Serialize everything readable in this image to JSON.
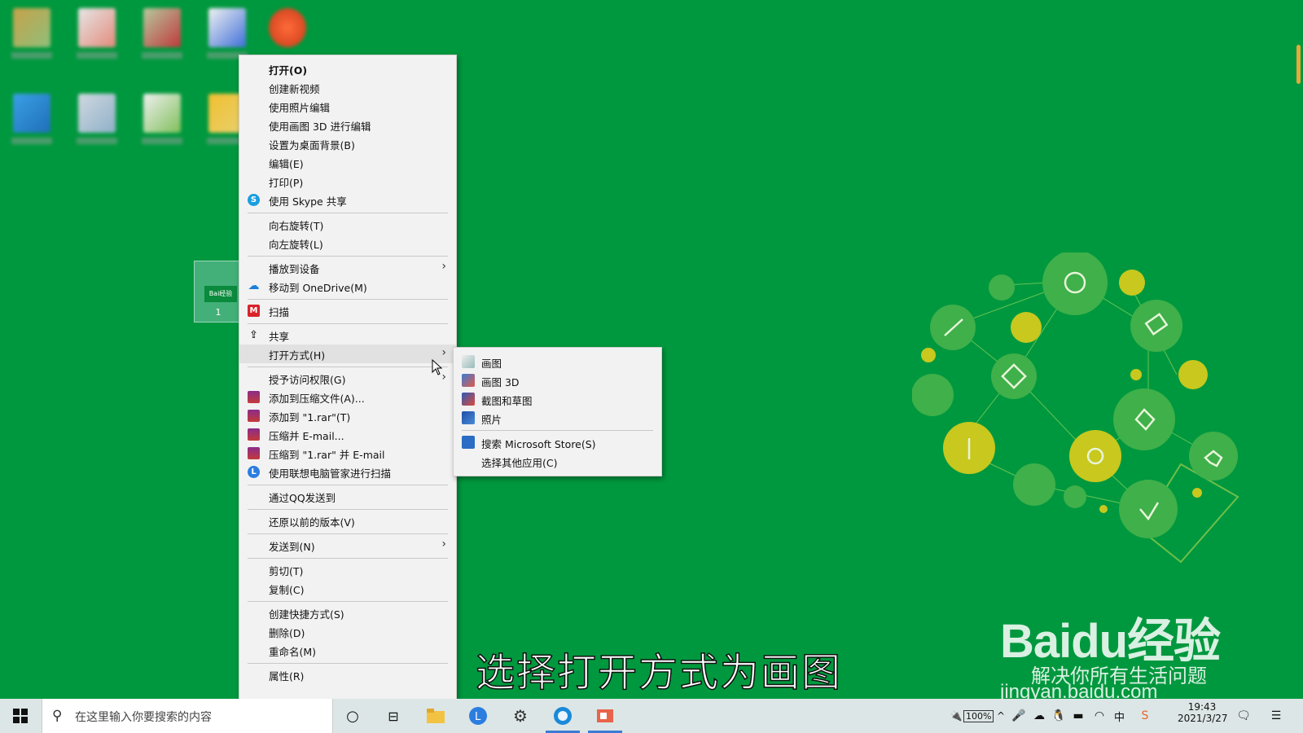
{
  "context_menu": {
    "items": [
      {
        "label": "打开(O)"
      },
      {
        "label": "创建新视频"
      },
      {
        "label": "使用照片编辑"
      },
      {
        "label": "使用画图 3D 进行编辑"
      },
      {
        "label": "设置为桌面背景(B)"
      },
      {
        "label": "编辑(E)"
      },
      {
        "label": "打印(P)"
      },
      {
        "label": "使用 Skype 共享"
      },
      {
        "label": "向右旋转(T)"
      },
      {
        "label": "向左旋转(L)"
      },
      {
        "label": "播放到设备"
      },
      {
        "label": "移动到 OneDrive(M)"
      },
      {
        "label": "扫描"
      },
      {
        "label": "共享"
      },
      {
        "label": "打开方式(H)"
      },
      {
        "label": "授予访问权限(G)"
      },
      {
        "label": "添加到压缩文件(A)..."
      },
      {
        "label": "添加到 \"1.rar\"(T)"
      },
      {
        "label": "压缩并 E-mail..."
      },
      {
        "label": "压缩到 \"1.rar\" 并 E-mail"
      },
      {
        "label": "使用联想电脑管家进行扫描"
      },
      {
        "label": "通过QQ发送到"
      },
      {
        "label": "还原以前的版本(V)"
      },
      {
        "label": "发送到(N)"
      },
      {
        "label": "剪切(T)"
      },
      {
        "label": "复制(C)"
      },
      {
        "label": "创建快捷方式(S)"
      },
      {
        "label": "删除(D)"
      },
      {
        "label": "重命名(M)"
      },
      {
        "label": "属性(R)"
      }
    ]
  },
  "open_with_submenu": {
    "items": [
      {
        "label": "画图"
      },
      {
        "label": "画图 3D"
      },
      {
        "label": "截图和草图"
      },
      {
        "label": "照片"
      },
      {
        "label": "搜索 Microsoft Store(S)"
      },
      {
        "label": "选择其他应用(C)"
      }
    ]
  },
  "desktop": {
    "selected_file_name": "1",
    "selected_file_thumb_text": "Bai经验"
  },
  "caption": "选择打开方式为画图",
  "watermark": {
    "brand": "Baidu经验",
    "slogan": "解决你所有生活问题",
    "url": "jingyan.baidu.com"
  },
  "taskbar": {
    "search_placeholder": "在这里输入你要搜索的内容",
    "battery": "100%",
    "ime": "中",
    "time": "19:43",
    "date": "2021/3/27"
  },
  "colors": {
    "desktop_bg": "#00983e",
    "menu_bg": "#f2f2f2",
    "taskbar_bg": "#dde6e6",
    "accent": "#3a7bd5"
  }
}
